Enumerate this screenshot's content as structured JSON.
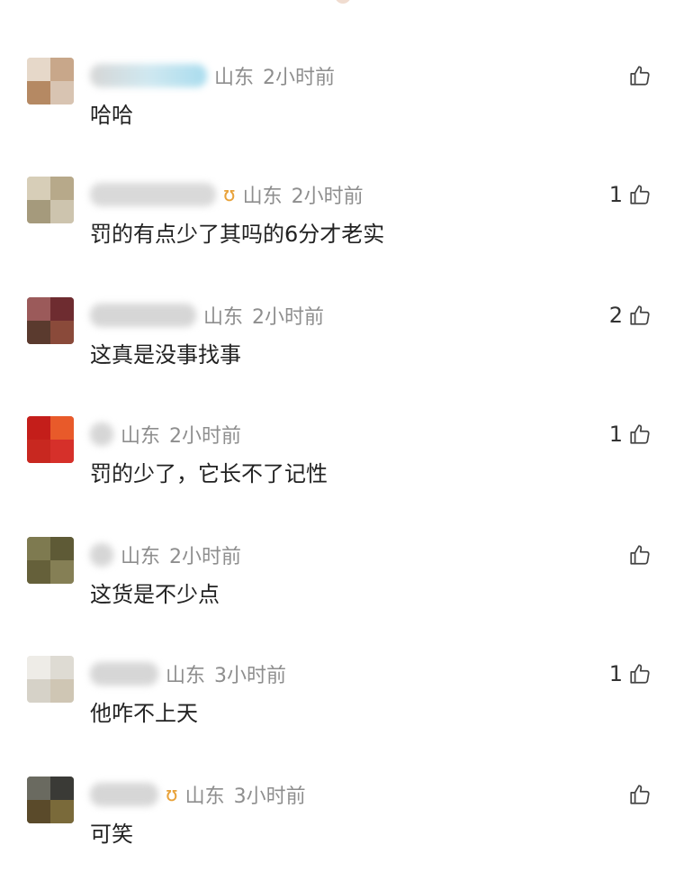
{
  "comments": [
    {
      "location": "山东",
      "time": "2小时前",
      "text": "哈哈",
      "likes": ""
    },
    {
      "location": "山东",
      "time": "2小时前",
      "text": "罚的有点少了其吗的6分才老实",
      "likes": "1"
    },
    {
      "location": "山东",
      "time": "2小时前",
      "text": "这真是没事找事",
      "likes": "2"
    },
    {
      "location": "山东",
      "time": "2小时前",
      "text": "罚的少了，它长不了记性",
      "likes": "1"
    },
    {
      "location": "山东",
      "time": "2小时前",
      "text": "这货是不少点",
      "likes": ""
    },
    {
      "location": "山东",
      "time": "3小时前",
      "text": "他咋不上天",
      "likes": "1"
    },
    {
      "location": "山东",
      "time": "3小时前",
      "text": "可笑",
      "likes": ""
    }
  ],
  "icons": {
    "like": "thumbs-up-icon",
    "badge": "vip-badge-icon"
  },
  "colors": {
    "meta_text": "#8e8e8e",
    "comment_text": "#222222",
    "badge": "#e8a23a"
  }
}
